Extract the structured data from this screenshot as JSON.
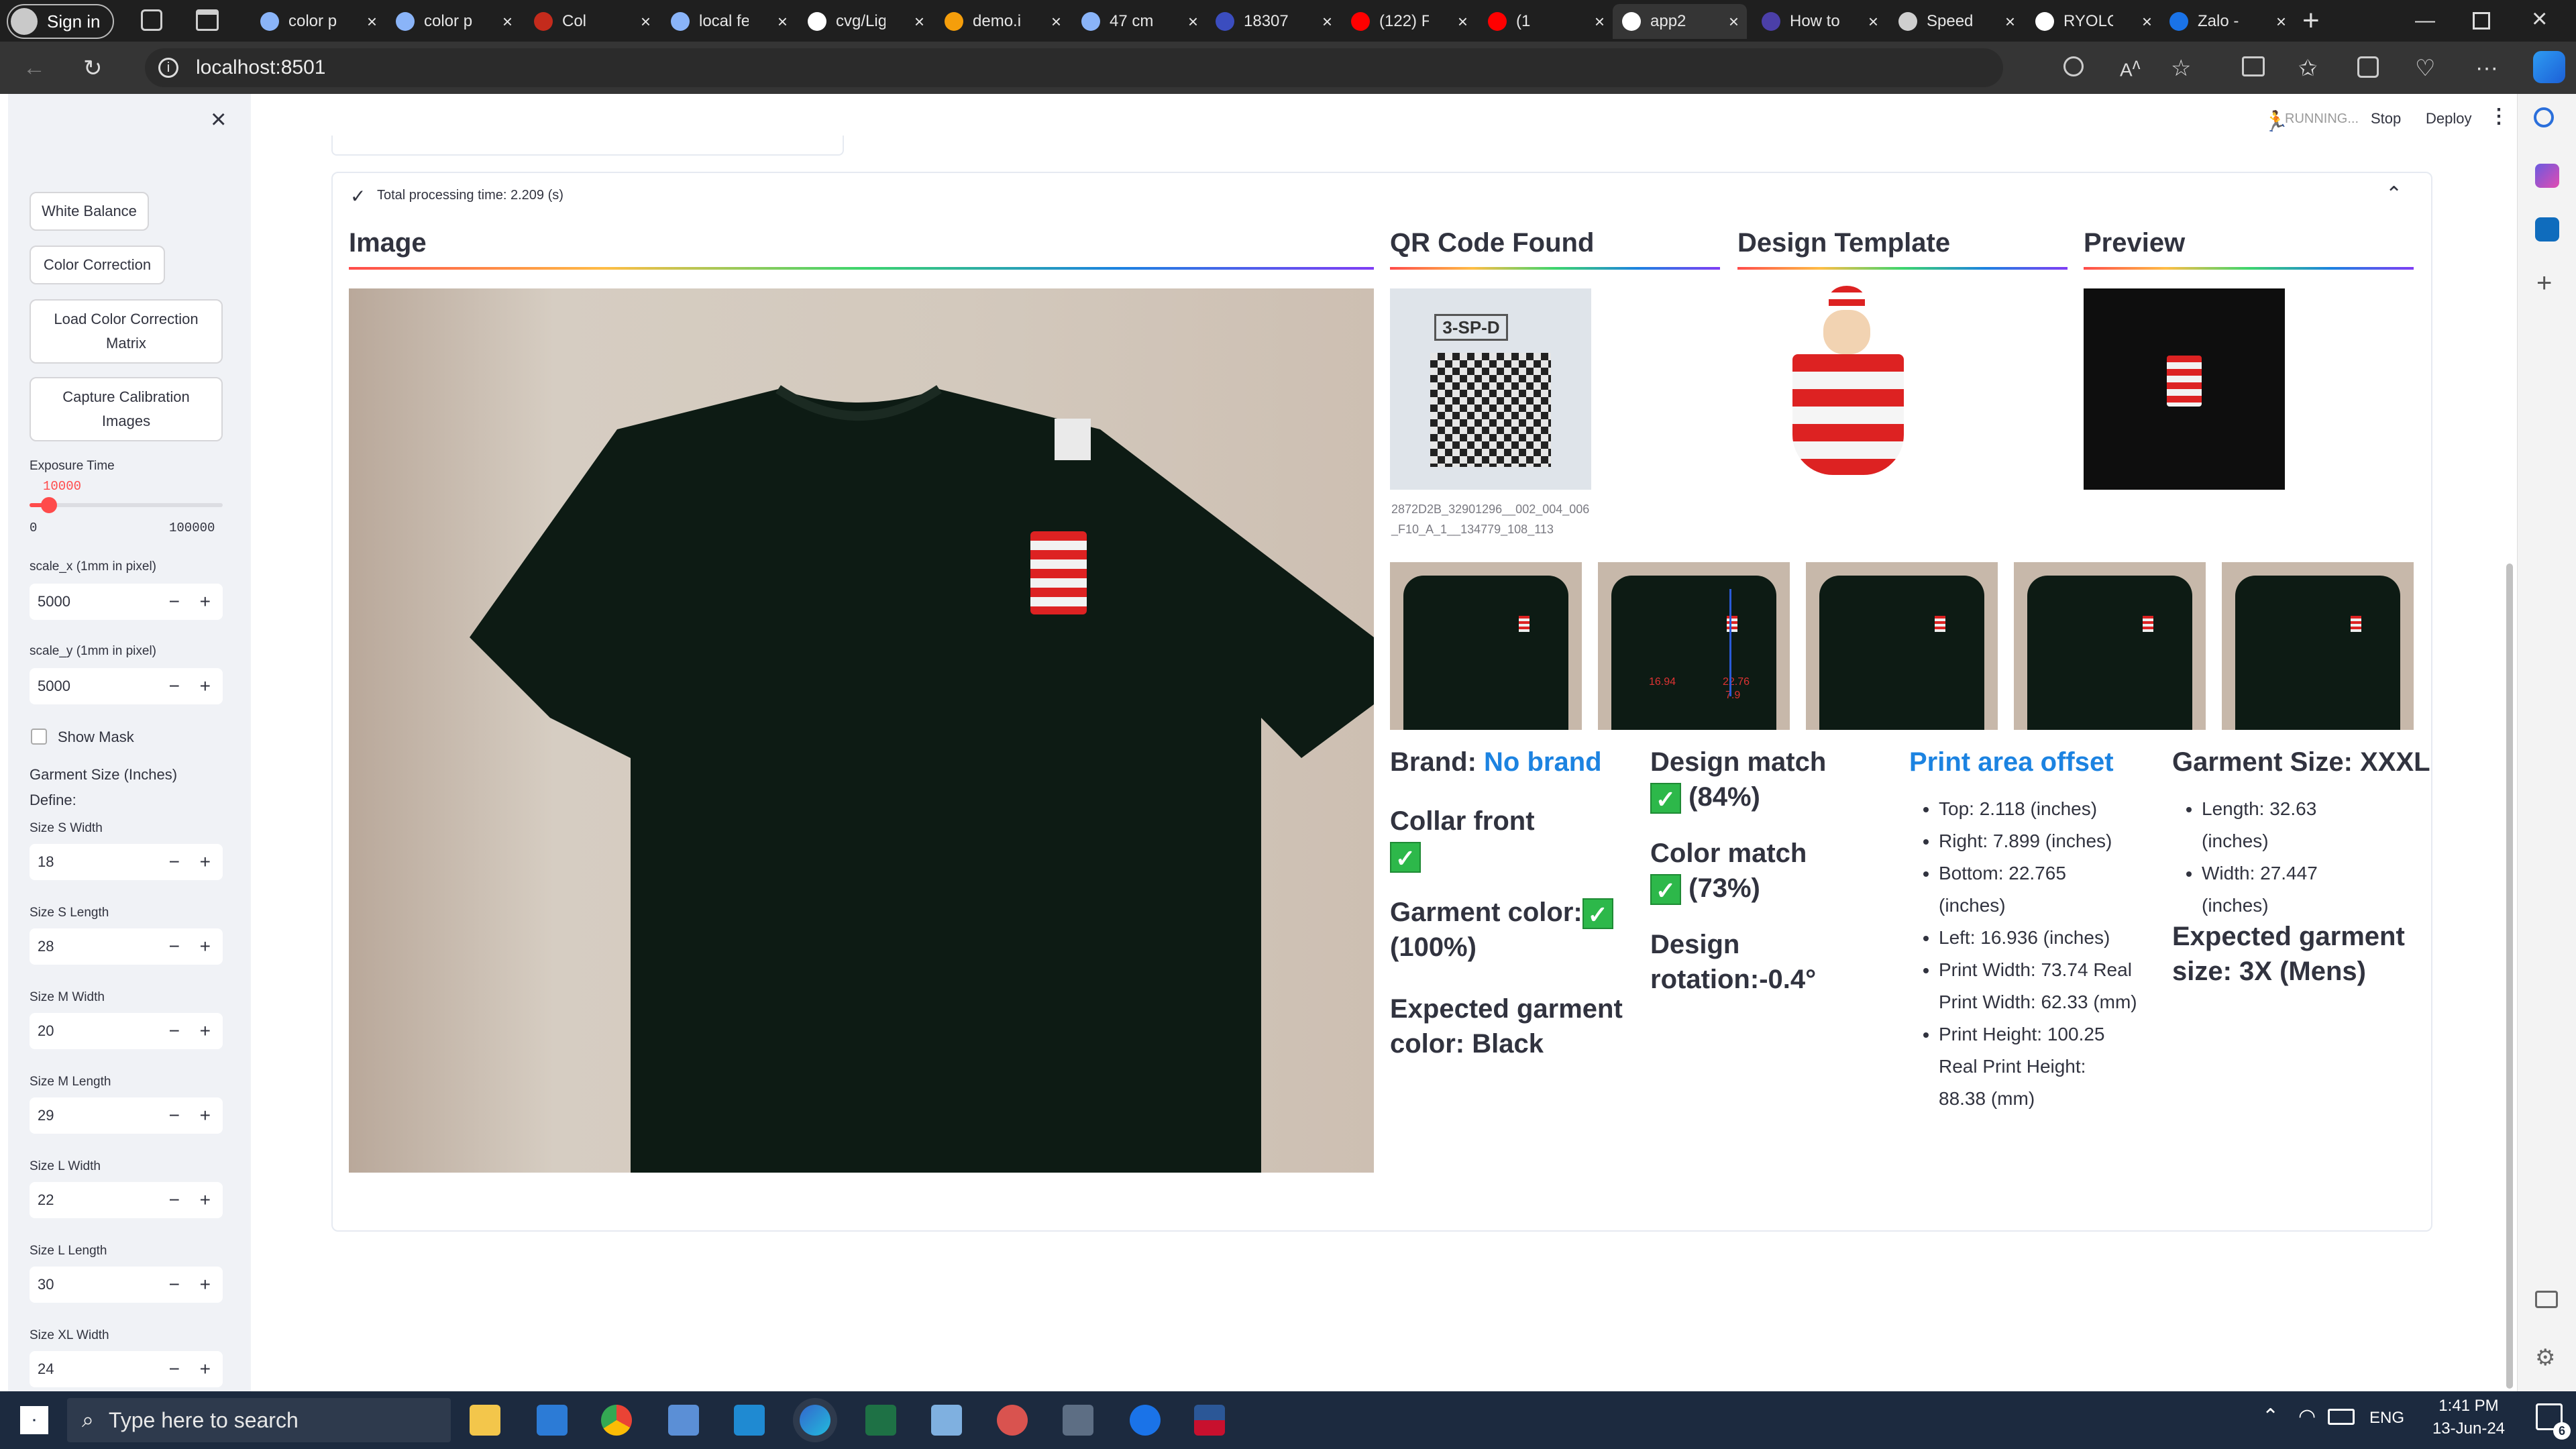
{
  "browser": {
    "signin": "Sign in",
    "tabs": [
      {
        "label": "color p",
        "color": "#8ab4f8"
      },
      {
        "label": "color p",
        "color": "#8ab4f8"
      },
      {
        "label": "Col",
        "color": "#c42b1c"
      },
      {
        "label": "local fe",
        "color": "#8ab4f8"
      },
      {
        "label": "cvg/Lig",
        "color": "#ffffff"
      },
      {
        "label": "demo.i",
        "color": "#f59e0b"
      },
      {
        "label": "47 cm",
        "color": "#8ab4f8"
      },
      {
        "label": "18307",
        "color": "#3b4dbf"
      },
      {
        "label": "(122) F",
        "color": "#ff0000"
      },
      {
        "label": "(1",
        "color": "#ff0000"
      },
      {
        "label": "app2",
        "color": "#ffffff"
      },
      {
        "label": "How to",
        "color": "#4b3fa8"
      },
      {
        "label": "Speed",
        "color": "#cfcfcf"
      },
      {
        "label": "RYOLC",
        "color": "#ffffff"
      },
      {
        "label": "Zalo -",
        "color": "#1a73e8"
      }
    ],
    "url": "localhost:8501"
  },
  "app": {
    "status": "RUNNING...",
    "stop": "Stop",
    "deploy": "Deploy"
  },
  "sidebar": {
    "close": "×",
    "white_balance": "White Balance",
    "color_correction": "Color Correction",
    "load_matrix": "Load Color Correction Matrix",
    "capture_calibration": "Capture Calibration Images",
    "exposure_label": "Exposure Time",
    "exposure_value": "10000",
    "exposure_min": "0",
    "exposure_max": "100000",
    "exposure_fraction": 0.1,
    "scale_x_label": "scale_x (1mm in pixel)",
    "scale_x": "5000",
    "scale_y_label": "scale_y (1mm in pixel)",
    "scale_y": "5000",
    "show_mask": "Show Mask",
    "garment_size_title": "Garment Size (Inches)",
    "define": "Define:",
    "sizes": [
      {
        "label": "Size S Width",
        "value": "18"
      },
      {
        "label": "Size S Length",
        "value": "28"
      },
      {
        "label": "Size M Width",
        "value": "20"
      },
      {
        "label": "Size M Length",
        "value": "29"
      },
      {
        "label": "Size L Width",
        "value": "22"
      },
      {
        "label": "Size L Length",
        "value": "30"
      },
      {
        "label": "Size XL Width",
        "value": "24"
      }
    ]
  },
  "result": {
    "processing_time": "Total processing time: 2.209 (s)",
    "headers": {
      "image": "Image",
      "qr": "QR Code Found",
      "design": "Design Template",
      "preview": "Preview"
    },
    "qr_label": "3-SP-D",
    "qr_caption": "2872D2B_32901296__002_004_006_F10_A_1__134779_108_113",
    "thumb_annotations": [
      "16.94",
      "22.76",
      "7.9"
    ],
    "brand_label": "Brand:",
    "brand_value": "No brand",
    "collar_front": "Collar front",
    "garment_color": "Garment color:",
    "garment_color_pct": "(100%)",
    "expected_color": "Expected garment color: Black",
    "design_match": "Design match",
    "design_match_pct": "(84%)",
    "color_match": "Color match",
    "color_match_pct": "(73%)",
    "design_rotation": "Design rotation:-0.4°",
    "print_area_title": "Print area offset",
    "print_area": [
      "Top: 2.118 (inches)",
      "Right: 7.899 (inches)",
      "Bottom: 22.765 (inches)",
      "Left: 16.936 (inches)",
      "Print Width: 73.74 Real Print Width: 62.33 (mm)",
      "Print Height: 100.25 Real Print Height: 88.38 (mm)"
    ],
    "garment_size_title": "Garment Size: XXXL",
    "garment_size": [
      "Length: 32.63 (inches)",
      "Width: 27.447 (inches)"
    ],
    "expected_size": "Expected garment size: 3X (Mens)"
  },
  "taskbar": {
    "search": "Type here to search",
    "lang": "ENG",
    "time": "1:41 PM",
    "date": "13-Jun-24",
    "notif": "6"
  }
}
